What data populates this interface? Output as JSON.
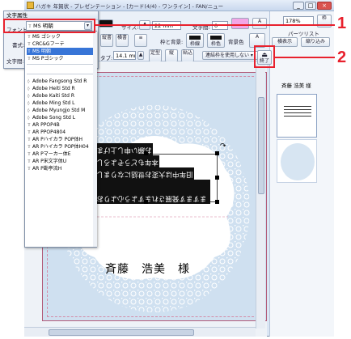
{
  "window": {
    "title": "ハガキ 年賀状 - プレゼンテーション - [カード(4/4) - ワンライン] - FAN/ニュー",
    "min": "_",
    "max": "□",
    "close": "×"
  },
  "dialog": {
    "title": "文字属性",
    "font_label": "フォント:",
    "font_value": "MS 明朝",
    "style_label": "書式:",
    "spacing_label": "文字間:"
  },
  "toolbar": {
    "size_label": "サイズ:",
    "size_value": "22 mm",
    "spacing_label": "文字間:",
    "spacing_value": "0",
    "tab_label": "タブ:",
    "tab_value": "14.1 mm",
    "border_label": "枠と背景:",
    "bg_label": "背景色",
    "line_label": "枠線",
    "color_label": "枠色",
    "connect_label": "連結枠を使用しない",
    "detail_label": "詳細",
    "end_label": "終了",
    "btn_vertical": "縦書",
    "btn_horizontal": "横書",
    "btn_fixed": "定型",
    "btn_vertical_alt": "縦",
    "btn_paste": "貼込"
  },
  "font_list": [
    "MS ゴシック",
    "CRC&Gフーテ",
    "MS 明朝",
    "MS Pゴシック",
    "Adobe Fangsong Std R",
    "Adobe Heiti Std R",
    "Adobe Kaiti Std R",
    "Adobe Ming Std L",
    "Adobe Myungjo Std M",
    "Adobe Song Std L",
    "AR PPOP4B",
    "AR PPOP4804",
    "AR Pハイカラ POP体H",
    "AR Pハイカラ POP体H04",
    "AR Pマーカー体E",
    "AR P宋文字体U",
    "AR P勘亭流H"
  ],
  "font_selected_index": 2,
  "right_panel": {
    "zoom": "178%",
    "zoom_unit": "枠",
    "parts_list": "パーツリスト",
    "show_btn": "横表示",
    "shrink_btn": "縮り込み",
    "thumb_caption": "斉藤 浩美 様"
  },
  "card": {
    "name_text": "斉藤　浩美　様",
    "message_lines": [
      "ますます発展されますよう心よりお祈り",
      "旧年中は大変お世話になりました",
      "本年もどうぞよろしく",
      "お願い申し上げます"
    ]
  },
  "callouts": {
    "one": "1",
    "two": "2"
  },
  "colors": {
    "accent": "#e8212d",
    "selection": "#3875d7",
    "card_border": "#b25a78",
    "lace_bg": "#cfe0f0"
  }
}
